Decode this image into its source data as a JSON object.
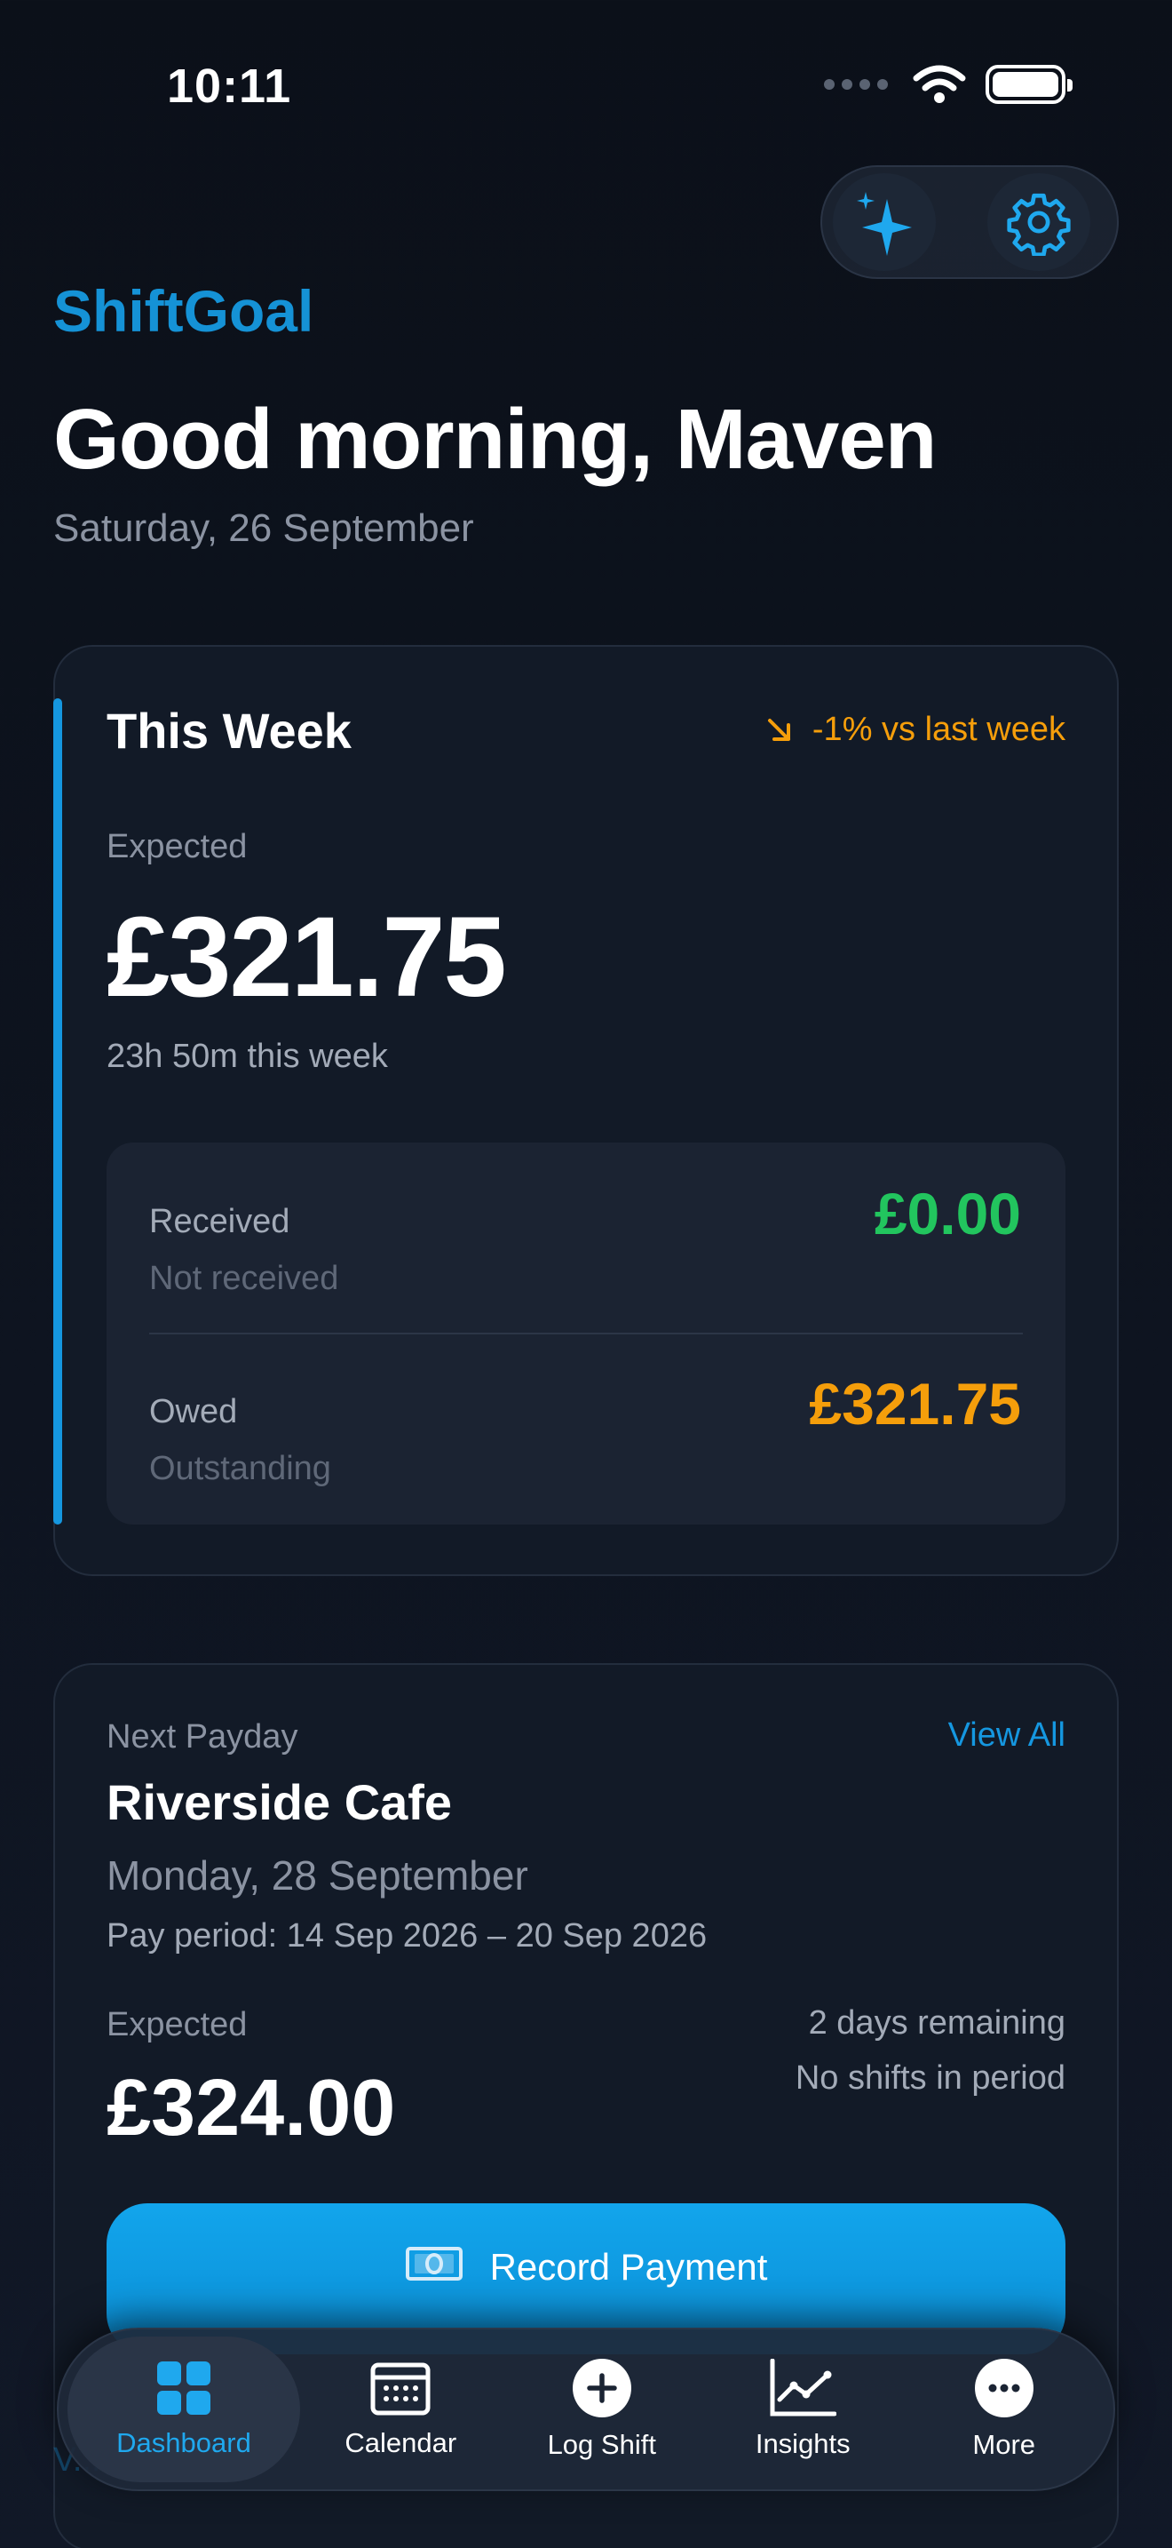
{
  "status_bar": {
    "time": "10:11"
  },
  "header": {
    "brand": "ShiftGoal",
    "greeting": "Good morning, Maven",
    "date": "Saturday, 26 September"
  },
  "this_week": {
    "title": "This Week",
    "trend": "-1% vs last week",
    "expected_label": "Expected",
    "expected_amount": "£321.75",
    "hours": "23h 50m this week",
    "received_label": "Received",
    "received_sub": "Not received",
    "received_amount": "£0.00",
    "owed_label": "Owed",
    "owed_sub": "Outstanding",
    "owed_amount": "£321.75"
  },
  "next_payday": {
    "label": "Next Payday",
    "view_all": "View All",
    "employer": "Riverside Cafe",
    "date": "Monday, 28 September",
    "pay_period": "Pay period: 14 Sep 2026 – 20 Sep 2026",
    "expected_label": "Expected",
    "expected_amount": "£324.00",
    "days_remaining": "2 days remaining",
    "shifts_note": "No shifts in period",
    "record_button": "Record Payment"
  },
  "behind_nav_link": "V...",
  "tabs": [
    {
      "label": "Dashboard",
      "icon": "grid-icon",
      "active": true
    },
    {
      "label": "Calendar",
      "icon": "calendar-icon",
      "active": false
    },
    {
      "label": "Log Shift",
      "icon": "plus-circle-icon",
      "active": false
    },
    {
      "label": "Insights",
      "icon": "chart-line-icon",
      "active": false
    },
    {
      "label": "More",
      "icon": "more-dots-icon",
      "active": false
    }
  ],
  "colors": {
    "accent": "#1597e0",
    "positive": "#22c55e",
    "warning": "#f59e0b",
    "background": "#0b1019",
    "card": "#121a27"
  }
}
